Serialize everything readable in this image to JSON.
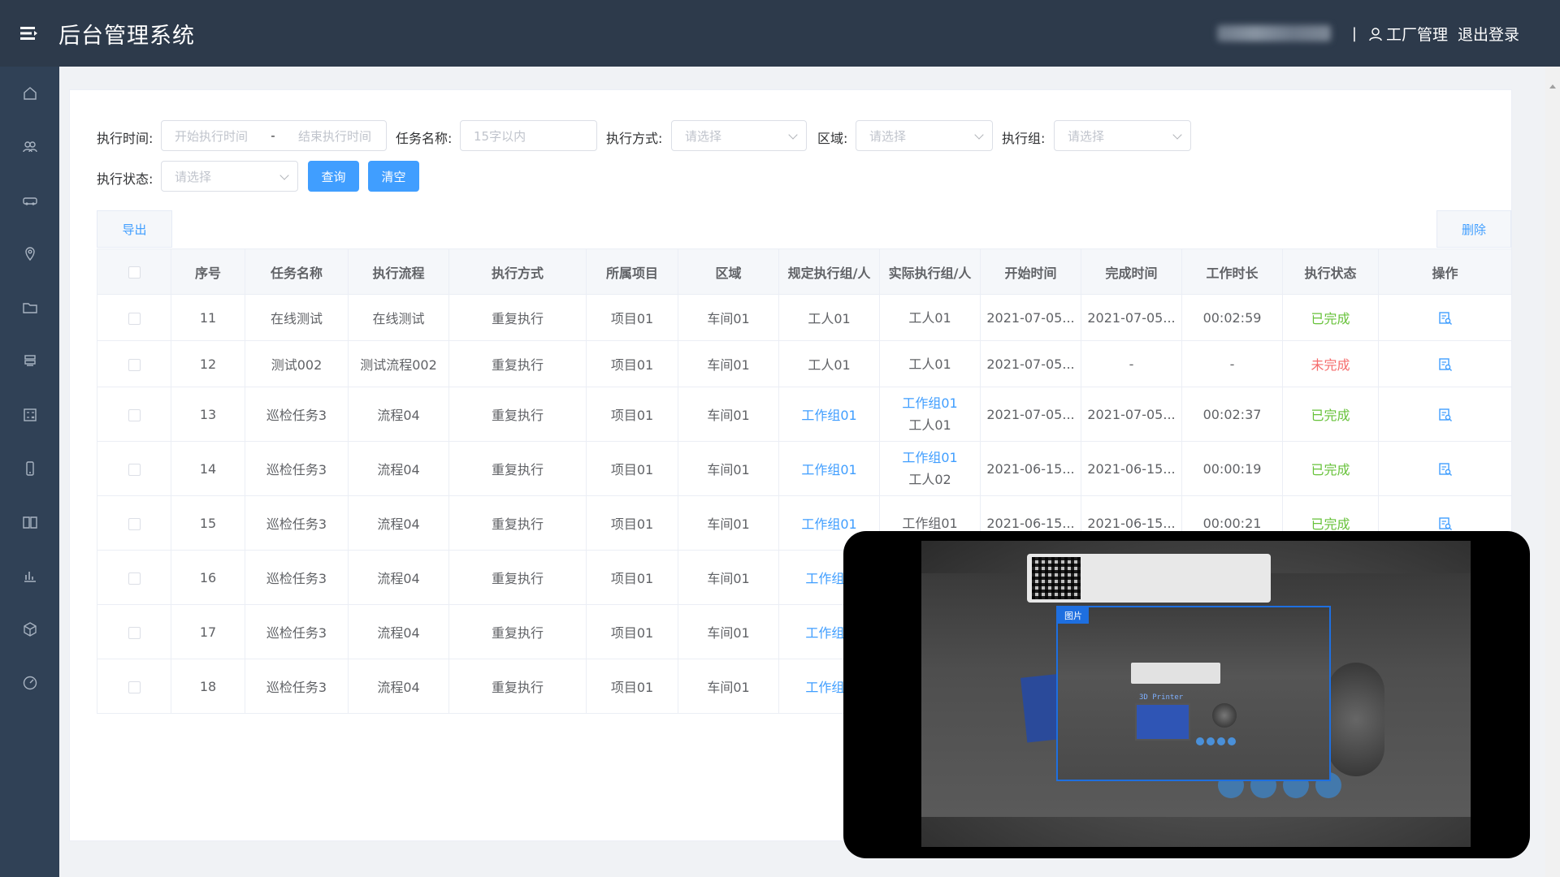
{
  "header": {
    "title": "后台管理系统",
    "separator": "|",
    "factory_label": "工厂管理",
    "logout_label": "退出登录"
  },
  "sidebar": {
    "icons": [
      "home-icon",
      "users-icon",
      "vehicle-icon",
      "location-icon",
      "folder-icon",
      "layers-icon",
      "calculator-icon",
      "phone-icon",
      "book-icon",
      "bar-chart-icon",
      "cube-icon",
      "dashboard-icon"
    ]
  },
  "filters": {
    "exec_time_label": "执行时间:",
    "start_placeholder": "开始执行时间",
    "range_sep": "-",
    "end_placeholder": "结束执行时间",
    "task_name_label": "任务名称:",
    "task_name_placeholder": "15字以内",
    "exec_mode_label": "执行方式:",
    "exec_mode_placeholder": "请选择",
    "area_label": "区域:",
    "area_placeholder": "请选择",
    "exec_group_label": "执行组:",
    "exec_group_placeholder": "请选择",
    "exec_status_label": "执行状态:",
    "exec_status_placeholder": "请选择",
    "query_label": "查询",
    "clear_label": "清空"
  },
  "toolbar": {
    "export_label": "导出",
    "delete_label": "删除"
  },
  "table": {
    "columns": [
      "序号",
      "任务名称",
      "执行流程",
      "执行方式",
      "所属项目",
      "区域",
      "规定执行组/人",
      "实际执行组/人",
      "开始时间",
      "完成时间",
      "工作时长",
      "执行状态",
      "操作"
    ],
    "rows": [
      {
        "no": "11",
        "name": "在线测试",
        "flow": "在线测试",
        "mode": "重复执行",
        "project": "项目01",
        "area": "车间01",
        "planned": "工人01",
        "actual1": "工人01",
        "actual2": "",
        "start": "2021-07-05...",
        "end": "2021-07-05...",
        "duration": "00:02:59",
        "status": "已完成"
      },
      {
        "no": "12",
        "name": "测试002",
        "flow": "测试流程002",
        "mode": "重复执行",
        "project": "项目01",
        "area": "车间01",
        "planned": "工人01",
        "actual1": "工人01",
        "actual2": "",
        "start": "2021-07-05...",
        "end": "-",
        "duration": "-",
        "status": "未完成"
      },
      {
        "no": "13",
        "name": "巡检任务3",
        "flow": "流程04",
        "mode": "重复执行",
        "project": "项目01",
        "area": "车间01",
        "planned": "工作组01",
        "actual1": "工作组01",
        "actual2": "工人01",
        "start": "2021-07-05...",
        "end": "2021-07-05...",
        "duration": "00:02:37",
        "status": "已完成"
      },
      {
        "no": "14",
        "name": "巡检任务3",
        "flow": "流程04",
        "mode": "重复执行",
        "project": "项目01",
        "area": "车间01",
        "planned": "工作组01",
        "actual1": "工作组01",
        "actual2": "工人02",
        "start": "2021-06-15...",
        "end": "2021-06-15...",
        "duration": "00:00:19",
        "status": "已完成"
      },
      {
        "no": "15",
        "name": "巡检任务3",
        "flow": "流程04",
        "mode": "重复执行",
        "project": "项目01",
        "area": "车间01",
        "planned": "工作组01",
        "actual1": "工作组01",
        "actual2": "",
        "start": "2021-06-15...",
        "end": "2021-06-15...",
        "duration": "00:00:21",
        "status": "已完成"
      },
      {
        "no": "16",
        "name": "巡检任务3",
        "flow": "流程04",
        "mode": "重复执行",
        "project": "项目01",
        "area": "车间01",
        "planned": "工作组0",
        "actual1": "",
        "actual2": "",
        "start": "",
        "end": "",
        "duration": "",
        "status": ""
      },
      {
        "no": "17",
        "name": "巡检任务3",
        "flow": "流程04",
        "mode": "重复执行",
        "project": "项目01",
        "area": "车间01",
        "planned": "工作组0",
        "actual1": "",
        "actual2": "",
        "start": "",
        "end": "",
        "duration": "",
        "status": ""
      },
      {
        "no": "18",
        "name": "巡检任务3",
        "flow": "流程04",
        "mode": "重复执行",
        "project": "项目01",
        "area": "车间01",
        "planned": "工作组0",
        "actual1": "",
        "actual2": "",
        "start": "",
        "end": "",
        "duration": "",
        "status": ""
      }
    ]
  },
  "preview": {
    "crop_label": "图片",
    "screen_text": "3D Printer"
  },
  "colors": {
    "header_bg": "#2d3a4b",
    "sidebar_bg": "#304156",
    "primary": "#409eff",
    "success": "#67c23a",
    "danger": "#f56c6c"
  }
}
